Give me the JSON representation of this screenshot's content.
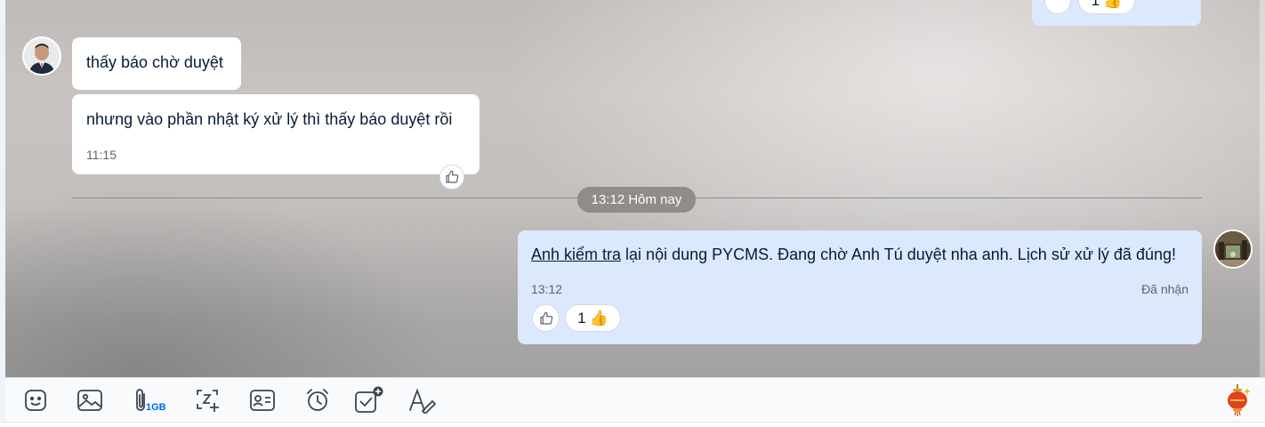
{
  "messages": {
    "top_partial": {
      "reaction_count": "1"
    },
    "m1": {
      "text": "thấy báo chờ duyệt"
    },
    "m2": {
      "text": "nhưng vào phần nhật ký xử lý thì thấy báo duyệt rồi",
      "time": "11:15"
    },
    "date_divider": "13:12 Hôm nay",
    "m3": {
      "link_text": "Anh kiểm tra",
      "text_rest": " lại nội dung PYCMS. Đang chờ Anh Tú duyệt nha anh. Lịch sử xử lý đã đúng!",
      "time": "13:12",
      "status": "Đã nhận",
      "reaction_count": "1"
    }
  },
  "toolbar": {
    "file_limit": "1GB",
    "icons": [
      "sticker-icon",
      "image-icon",
      "attachment-icon",
      "screenshot-icon",
      "contact-card-icon",
      "reminder-icon",
      "todo-icon",
      "format-text-icon",
      "lantern-icon"
    ]
  },
  "colors": {
    "outgoing_bubble": "#dbe8fd",
    "incoming_bubble": "#ffffff",
    "accent": "#0068ff"
  }
}
